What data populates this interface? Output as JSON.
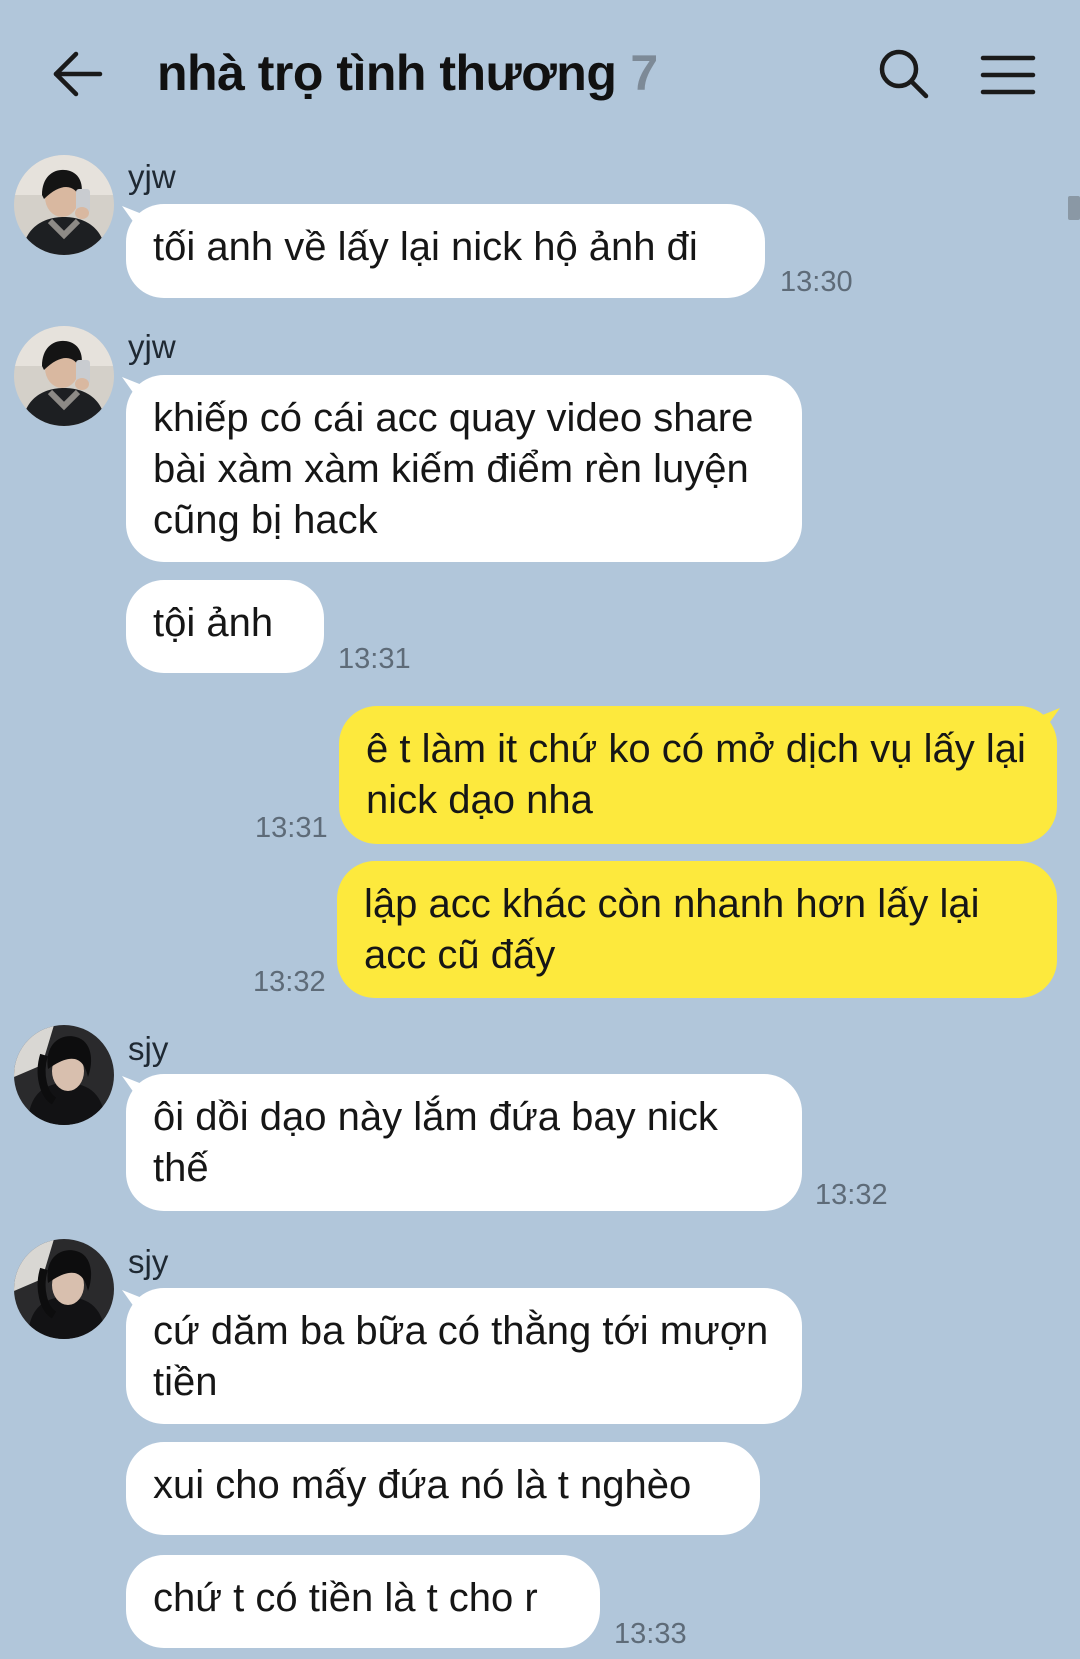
{
  "header": {
    "title": "nhà trọ tình thương",
    "member_count": "7",
    "back_icon": "arrow-left-icon",
    "search_icon": "search-icon",
    "menu_icon": "hamburger-menu-icon"
  },
  "colors": {
    "background": "#b1c6da",
    "incoming_bubble": "#ffffff",
    "outgoing_bubble": "#fde93d"
  },
  "messages": [
    {
      "sender": "yjw",
      "text": "tối anh về lấy lại nick hộ ảnh đi",
      "time": "13:30",
      "direction": "incoming"
    },
    {
      "sender": "yjw",
      "text": "khiếp có cái acc quay video share bài xàm xàm kiếm điểm rèn luyện cũng bị hack",
      "time": "",
      "direction": "incoming"
    },
    {
      "sender": "",
      "text": "tội ảnh",
      "time": "13:31",
      "direction": "incoming"
    },
    {
      "sender": "",
      "text": "ê t làm it chứ ko có mở dịch vụ lấy lại nick dạo nha",
      "time": "13:31",
      "direction": "outgoing"
    },
    {
      "sender": "",
      "text": "lập acc khác còn nhanh hơn lấy lại acc cũ đấy",
      "time": "13:32",
      "direction": "outgoing"
    },
    {
      "sender": "sjy",
      "text": "ôi dồi dạo này lắm đứa bay nick thế",
      "time": "13:32",
      "direction": "incoming"
    },
    {
      "sender": "sjy",
      "text": "cứ dăm ba bữa có thằng tới mượn tiền",
      "time": "",
      "direction": "incoming"
    },
    {
      "sender": "",
      "text": "xui cho mấy đứa nó là t nghèo",
      "time": "",
      "direction": "incoming"
    },
    {
      "sender": "",
      "text": "chứ t có tiền là t cho r",
      "time": "13:33",
      "direction": "incoming"
    }
  ]
}
